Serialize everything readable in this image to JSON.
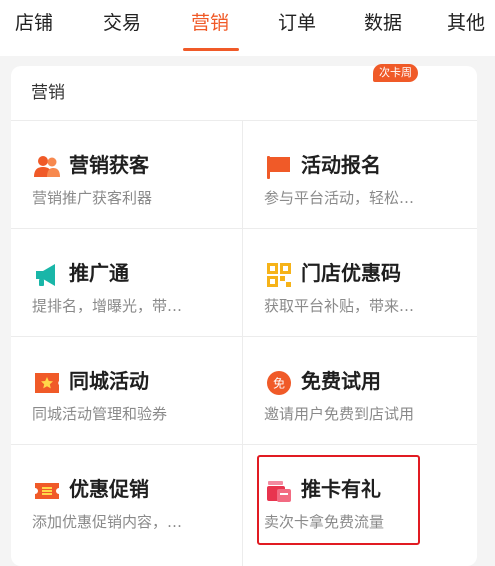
{
  "tabs": [
    {
      "label": "店铺"
    },
    {
      "label": "交易"
    },
    {
      "label": "营销"
    },
    {
      "label": "订单"
    },
    {
      "label": "数据"
    },
    {
      "label": "其他"
    }
  ],
  "active_tab": "营销",
  "section": {
    "title": "营销",
    "items": [
      {
        "name": "营销获客",
        "desc": "营销推广获客利器",
        "icon": "people-icon"
      },
      {
        "name": "活动报名",
        "desc": "参与平台活动，轻松…",
        "icon": "flag-icon",
        "badge": "次卡周"
      },
      {
        "name": "推广通",
        "desc": "提排名，增曝光，带…",
        "icon": "megaphone-icon"
      },
      {
        "name": "门店优惠码",
        "desc": "获取平台补贴，带来…",
        "icon": "qr-code-icon"
      },
      {
        "name": "同城活动",
        "desc": "同城活动管理和验券",
        "icon": "star-ticket-icon"
      },
      {
        "name": "免费试用",
        "desc": "邀请用户免费到店试用",
        "icon": "free-coin-icon",
        "icon_text": "免"
      },
      {
        "name": "优惠促销",
        "desc": "添加优惠促销内容，…",
        "icon": "coupon-icon"
      },
      {
        "name": "推卡有礼",
        "desc": "卖次卡拿免费流量",
        "icon": "gift-card-icon"
      }
    ]
  },
  "colors": {
    "accent": "#f05a28",
    "teal": "#19b6a8",
    "yellow": "#f6b319",
    "highlight": "#e11b22"
  }
}
